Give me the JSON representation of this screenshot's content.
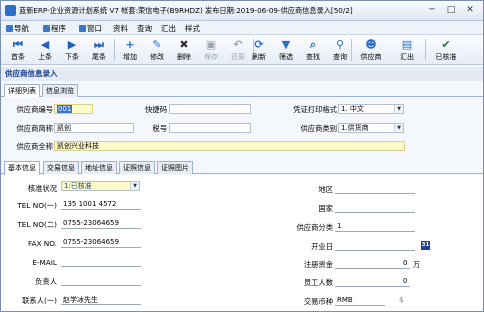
{
  "window": {
    "title": "蓝新ERP-企业资源计划系统 V7 帐套:荣信电子(B9RHDZ) 发布日期:2019-06-09-供应商信息录入[50/2]",
    "controls": {
      "minimize": "─",
      "maximize": "□",
      "close": "✕"
    }
  },
  "menubar": {
    "items": [
      {
        "label": "导航",
        "color": "#3b78c8"
      },
      {
        "label": "程序",
        "color": "#3b78c8"
      },
      {
        "label": "窗口",
        "color": "#3b78c8"
      },
      {
        "label": "资料",
        "color": ""
      },
      {
        "label": "查询",
        "color": ""
      },
      {
        "label": "汇出",
        "color": ""
      },
      {
        "label": "样式",
        "color": ""
      }
    ]
  },
  "toolbar": {
    "buttons": [
      {
        "label": "首条",
        "glyph": "⏮",
        "icon": "first-record-icon",
        "color": "#1f5fbf",
        "disabled": false
      },
      {
        "label": "上条",
        "glyph": "◀",
        "icon": "previous-record-icon",
        "color": "#1f5fbf",
        "disabled": false
      },
      {
        "label": "下条",
        "glyph": "▶",
        "icon": "next-record-icon",
        "color": "#1f5fbf",
        "disabled": false
      },
      {
        "label": "尾条",
        "glyph": "⏭",
        "icon": "last-record-icon",
        "color": "#1f5fbf",
        "disabled": false
      },
      {
        "label": "增加",
        "glyph": "+",
        "icon": "add-icon",
        "color": "#2a6fc9",
        "disabled": false
      },
      {
        "label": "修改",
        "glyph": "✎",
        "icon": "edit-icon",
        "color": "#2a6fc9",
        "disabled": false
      },
      {
        "label": "删除",
        "glyph": "✖",
        "icon": "delete-icon",
        "color": "#333333",
        "disabled": false
      },
      {
        "label": "保存",
        "glyph": "▣",
        "icon": "save-icon",
        "color": "#9aa3ad",
        "disabled": true
      },
      {
        "label": "还原",
        "glyph": "↶",
        "icon": "undo-icon",
        "color": "#9aa3ad",
        "disabled": true
      },
      {
        "label": "刷新",
        "glyph": "⟳",
        "icon": "refresh-icon",
        "color": "#2a6fc9",
        "disabled": false
      },
      {
        "label": "筛选",
        "glyph": "▼",
        "icon": "filter-icon",
        "color": "#2a6fc9",
        "disabled": false
      },
      {
        "label": "查找",
        "glyph": "⌕",
        "icon": "find-icon",
        "color": "#2a6fc9",
        "disabled": false
      },
      {
        "label": "查询",
        "glyph": "⚲",
        "icon": "query-icon",
        "color": "#2a6fc9",
        "disabled": false
      },
      {
        "label": "供应商",
        "glyph": "☻",
        "icon": "supplier-icon",
        "color": "#2a6fc9",
        "disabled": false
      },
      {
        "label": "汇出",
        "glyph": "▤",
        "icon": "export-icon",
        "color": "#2a6fc9",
        "disabled": false
      },
      {
        "label": "已核准",
        "glyph": "✔",
        "icon": "approved-icon",
        "color": "#1f7a3a",
        "disabled": false
      }
    ]
  },
  "section_title": "供应商信息录入",
  "tabs_top": [
    "详细列表",
    "信息浏览"
  ],
  "header_form": {
    "supplier_code_label": "供应商编号",
    "supplier_code_value": "001",
    "quick_code_label": "快捷码",
    "quick_code_value": "",
    "print_format_label": "凭证打印格式",
    "print_format_value": "1. 中文",
    "supplier_short_label": "供应商简称",
    "supplier_short_value": "凯创",
    "tax_no_label": "税号",
    "tax_no_value": "",
    "supplier_type_label": "供应商类别",
    "supplier_type_value": "1.供货商",
    "supplier_full_label": "供应商全称",
    "supplier_full_value": "凯创兴业科技"
  },
  "tabs_bottom": [
    "基本信息",
    "交易信息",
    "地址信息",
    "证照信息",
    "证照图片"
  ],
  "basic_info": {
    "approval_status_label": "核准状况",
    "approval_status_value": "1:已核准",
    "tel1_label": "TEL NO(一)",
    "tel1_value": "135 1001 4572",
    "tel2_label": "TEL NO(二)",
    "tel2_value": "0755-23064659",
    "fax_label": "FAX NO.",
    "fax_value": "0755-23064659",
    "email_label": "E-MAIL",
    "email_value": "",
    "manager_label": "负责人",
    "manager_value": "",
    "contact1_label": "联系人(一)",
    "contact1_value": "赵学冰先生",
    "region_label": "地区",
    "region_value": "",
    "country_label": "国家",
    "country_value": "",
    "supplier_class_label": "供应商分类",
    "supplier_class_value": "1",
    "open_date_label": "开业日",
    "open_date_value": "",
    "calendar_glyph": "31",
    "capital_label": "注册资金",
    "capital_value": "0",
    "capital_unit": "万",
    "staff_label": "员工人数",
    "staff_value": "0",
    "currency_label": "交易币种",
    "currency_value": "RMB",
    "currency_symbol": "$"
  }
}
